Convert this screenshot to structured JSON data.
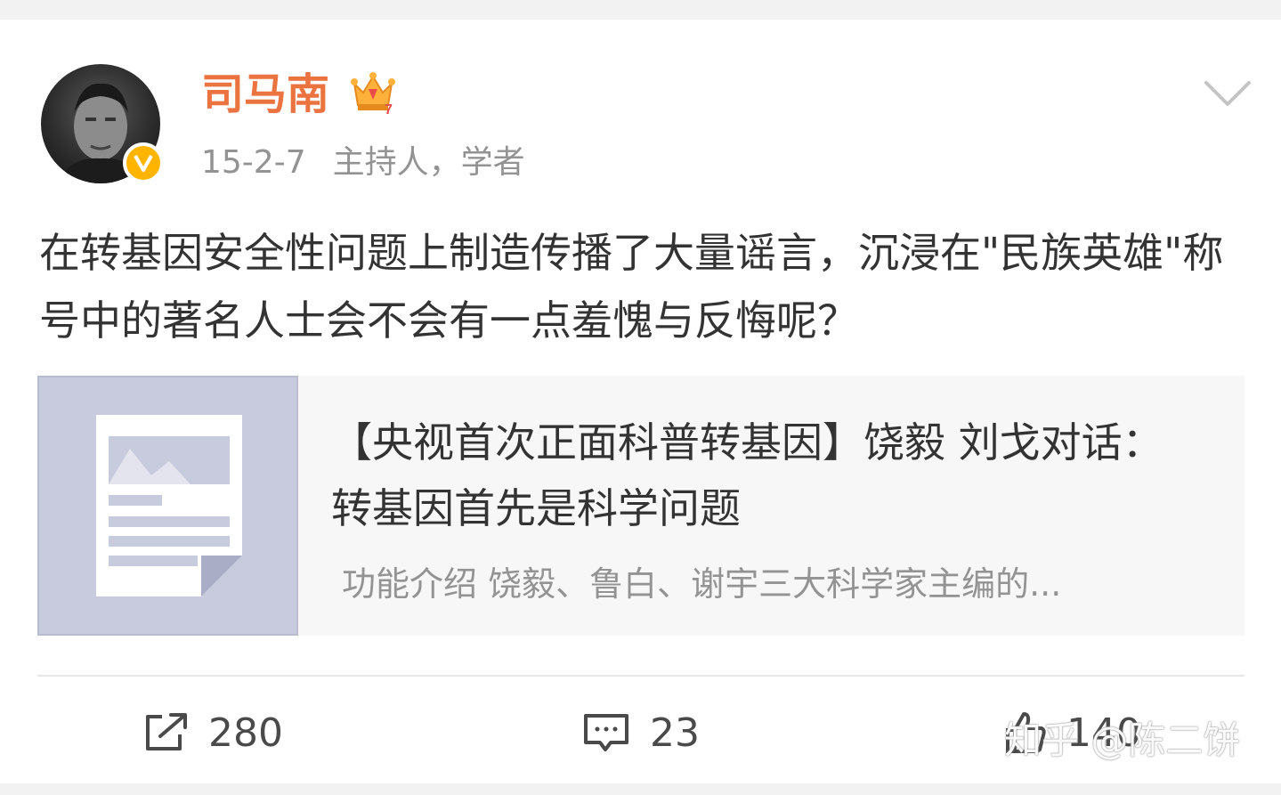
{
  "post": {
    "username": "司马南",
    "date": "15-2-7",
    "verified_title": "主持人，学者",
    "text": "在转基因安全性问题上制造传播了大量谣言，沉浸在\"民族英雄\"称号中的著名人士会不会有一点羞愧与反悔呢？"
  },
  "link_card": {
    "title": "【央视首次正面科普转基因】饶毅 刘戈对话：转基因首先是科学问题",
    "description": "功能介绍 饶毅、鲁白、谢宇三大科学家主编的..."
  },
  "actions": {
    "repost_count": "280",
    "comment_count": "23",
    "like_count": "140"
  },
  "watermark": "知乎 @陈二饼",
  "icons": {
    "verified": "verified-badge-icon",
    "crown": "crown-icon",
    "chevron": "chevron-down-icon",
    "thumb": "image-placeholder-icon",
    "repost": "repost-icon",
    "comment": "comment-icon",
    "like": "thumb-up-icon"
  },
  "colors": {
    "username": "#eb7340",
    "meta": "#939393",
    "verified": "#ffb400",
    "thumb_bg": "#c8cade"
  }
}
